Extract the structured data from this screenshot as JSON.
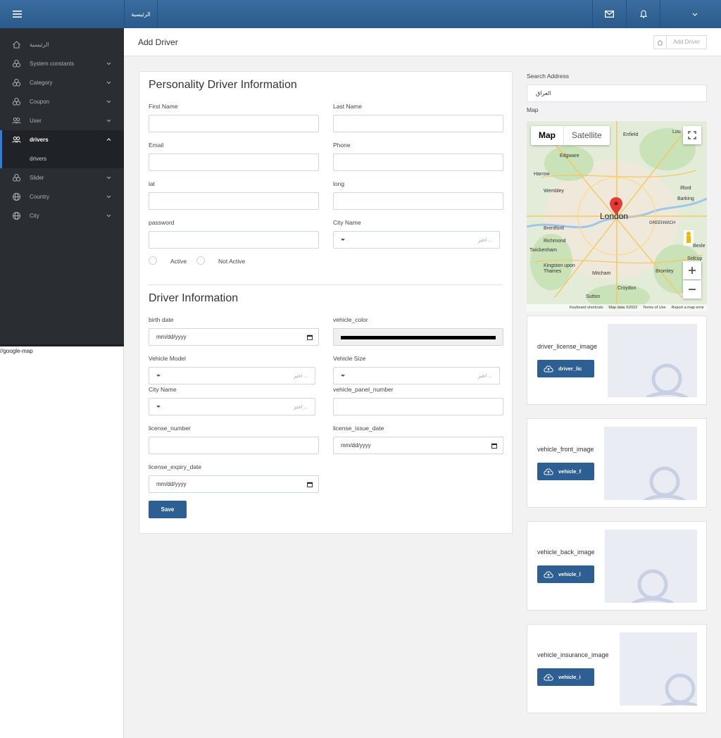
{
  "topbar": {
    "brand": "الرئيسية"
  },
  "sidebar": {
    "items": [
      {
        "label": "الرئيسية",
        "icon": "home-icon"
      },
      {
        "label": "System constants",
        "icon": "boxes-icon"
      },
      {
        "label": "Category",
        "icon": "boxes-icon"
      },
      {
        "label": "Coupon",
        "icon": "boxes-icon"
      },
      {
        "label": "User",
        "icon": "users-icon"
      },
      {
        "label": "drivers",
        "icon": "users-icon"
      },
      {
        "label": "Slider",
        "icon": "boxes-icon"
      },
      {
        "label": "Country",
        "icon": "globe-icon"
      },
      {
        "label": "City",
        "icon": "globe-icon"
      }
    ],
    "sub_item": "drivers",
    "note": "//google-map"
  },
  "page": {
    "title": "Add Driver",
    "breadcrumb_current": "Add Driver"
  },
  "personal": {
    "title": "Personality Driver Information",
    "first_name": "First Name",
    "last_name": "Last Name",
    "email": "Email",
    "phone": "Phone",
    "lat": "lat",
    "long": "long",
    "password": "password",
    "city_name": "City Name",
    "city_placeholder": "اختر ...",
    "active": "Active",
    "not_active": "Not Active"
  },
  "driver": {
    "title": "Driver Information",
    "birth_date": "birth date",
    "date_placeholder": "mm/dd/yyyy",
    "vehicle_color": "vehicle_color",
    "vehicle_model": "Vehicle Model",
    "vehicle_size": "Vehicle Size",
    "city_name": "City Name",
    "select_placeholder": "اختر ...",
    "vehicle_panel_number": "vehicle_panel_number",
    "license_number": "license_number",
    "license_issue_date": "license_issue_date",
    "license_expiry_date": "license_expiry_date",
    "save": "Save"
  },
  "right": {
    "search_label": "Search Address",
    "search_value": "العراق",
    "map_label": "Map",
    "map": {
      "tab_map": "Map",
      "tab_satellite": "Satellite",
      "places": [
        "Enfield",
        "Edgware",
        "Harrow",
        "Wembley",
        "Ilford",
        "Barking",
        "London",
        "Brentford",
        "Richmond",
        "Twickenham",
        "GREENWICH",
        "Kingston upon Thames",
        "Mitcham",
        "Bromley",
        "Croydon",
        "Sutton",
        "Sidcup",
        "Bexle",
        "Lou"
      ],
      "footer": [
        "Keyboard shortcuts",
        "Map data ©2022",
        "Terms of Use",
        "Report a map error"
      ]
    },
    "uploads": [
      {
        "label": "driver_license_image",
        "button": "driver_lic"
      },
      {
        "label": "vehicle_front_image",
        "button": "vehicle_f"
      },
      {
        "label": "vehicle_back_image",
        "button": "vehicle_l"
      },
      {
        "label": "vehicle_insurance_image",
        "button": "vehicle_i"
      }
    ]
  },
  "colors": {
    "primary": "#2d5f93",
    "sidebar": "#2a2e33",
    "active_accent": "#2f7fd6"
  }
}
